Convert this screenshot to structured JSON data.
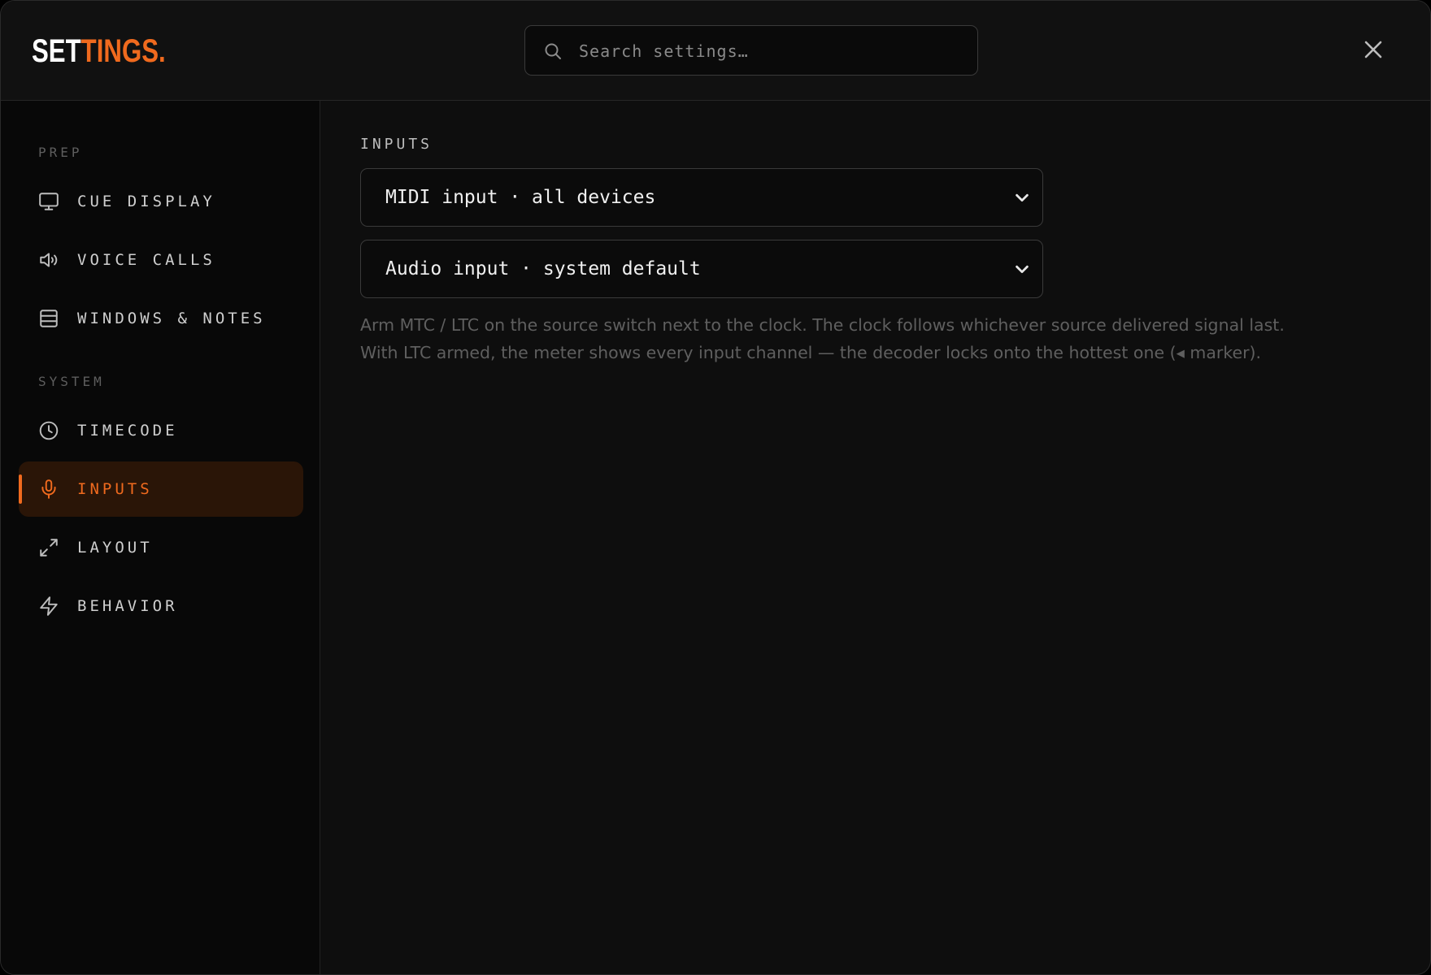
{
  "header": {
    "logo_main": "SET",
    "logo_accent": "TINGS.",
    "search_placeholder": "Search settings…"
  },
  "sidebar": {
    "sections": [
      {
        "title": "PREP",
        "items": [
          {
            "label": "CUE DISPLAY",
            "icon": "monitor-icon"
          },
          {
            "label": "VOICE CALLS",
            "icon": "speaker-icon"
          },
          {
            "label": "WINDOWS & NOTES",
            "icon": "list-icon"
          }
        ]
      },
      {
        "title": "SYSTEM",
        "items": [
          {
            "label": "TIMECODE",
            "icon": "clock-icon"
          },
          {
            "label": "INPUTS",
            "icon": "microphone-icon",
            "active": true
          },
          {
            "label": "LAYOUT",
            "icon": "expand-icon"
          },
          {
            "label": "BEHAVIOR",
            "icon": "lightning-icon"
          }
        ]
      }
    ]
  },
  "main": {
    "title": "INPUTS",
    "midi_select": "MIDI input · all devices",
    "audio_select": "Audio input · system default",
    "help_line1": "Arm MTC / LTC on the source switch next to the clock. The clock follows whichever source delivered signal last.",
    "help_line2": "With LTC armed, the meter shows every input channel — the decoder locks onto the hottest one (◂ marker)."
  },
  "colors": {
    "accent": "#f06a1e",
    "active_bg": "#2a1507",
    "background": "#0e0e0e",
    "sidebar_bg": "#080808"
  }
}
